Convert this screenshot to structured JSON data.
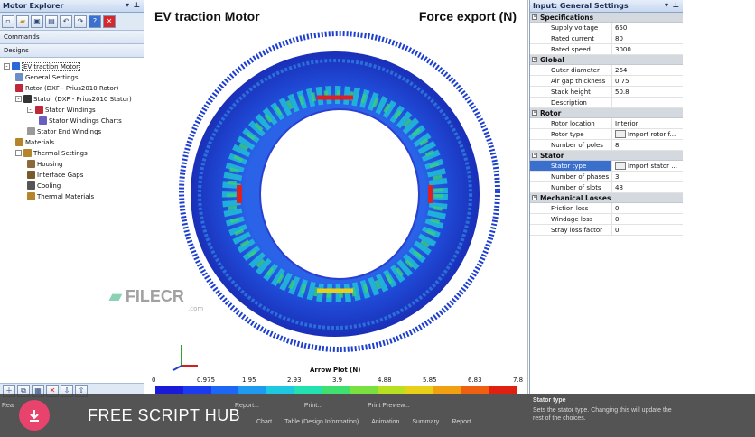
{
  "left_panel": {
    "title": "Motor Explorer",
    "pin_icons": [
      "▾",
      "⊥"
    ],
    "toolbar_icons": [
      "new-icon",
      "open-icon",
      "save-icon",
      "save-as-icon",
      "undo-icon",
      "redo-icon",
      "help-icon",
      "close-icon"
    ],
    "commands_label": "Commands",
    "designs_label": "Designs",
    "tree": [
      {
        "label": "EV traction Motor",
        "level": 0,
        "icon": "motor-icon",
        "color": "#2a6ad8",
        "exp": "-"
      },
      {
        "label": "General Settings",
        "level": 1,
        "icon": "gear-icon",
        "color": "#6a8fc9"
      },
      {
        "label": "Rotor (DXF - Prius2010 Rotor)",
        "level": 1,
        "icon": "rotor-icon",
        "color": "#c0283a"
      },
      {
        "label": "Stator (DXF - Prius2010 Stator)",
        "level": 1,
        "icon": "stator-icon",
        "color": "#333333",
        "exp": "-"
      },
      {
        "label": "Stator Windings",
        "level": 2,
        "icon": "windings-icon",
        "color": "#c0283a",
        "exp": "-"
      },
      {
        "label": "Stator Windings Charts",
        "level": 3,
        "icon": "chart-icon",
        "color": "#6a5fbf"
      },
      {
        "label": "Stator End Windings",
        "level": 2,
        "icon": "end-windings-icon",
        "color": "#9a9a9a"
      },
      {
        "label": "Materials",
        "level": 1,
        "icon": "materials-icon",
        "color": "#b5852c"
      },
      {
        "label": "Thermal Settings",
        "level": 1,
        "icon": "thermal-icon",
        "color": "#b5852c",
        "exp": "-"
      },
      {
        "label": "Housing",
        "level": 2,
        "icon": "housing-icon",
        "color": "#8a6a3a"
      },
      {
        "label": "Interface Gaps",
        "level": 2,
        "icon": "interface-gaps-icon",
        "color": "#7a5a2a"
      },
      {
        "label": "Cooling",
        "level": 2,
        "icon": "cooling-icon",
        "color": "#555555"
      },
      {
        "label": "Thermal Materials",
        "level": 2,
        "icon": "thermal-materials-icon",
        "color": "#b5852c"
      }
    ]
  },
  "center": {
    "title_left": "EV traction Motor",
    "title_right": "Force export (N)",
    "watermark": "FILECR",
    "watermark_sub": ".com",
    "colorbar": {
      "title": "Arrow Plot (N)",
      "ticks": [
        "0",
        "0.975",
        "1.95",
        "2.93",
        "3.9",
        "4.88",
        "5.85",
        "6.83",
        "7.8"
      ],
      "colors": [
        "#1a1ad8",
        "#1c3af0",
        "#1e66f5",
        "#1e9af0",
        "#1ec8e0",
        "#22e0b0",
        "#40e070",
        "#7ae040",
        "#b8e020",
        "#e8d018",
        "#f0a010",
        "#f06010",
        "#e02010"
      ]
    },
    "buttons": [
      "Report...",
      "Print...",
      "Print Preview..."
    ],
    "tabs": [
      "Chart",
      "Table (Design Information)",
      "Animation",
      "Summary",
      "Report"
    ]
  },
  "right_panel": {
    "title": "Input: General Settings",
    "groups": [
      {
        "name": "Specifications",
        "rows": [
          {
            "name": "Supply voltage",
            "value": "650"
          },
          {
            "name": "Rated current",
            "value": "80"
          },
          {
            "name": "Rated speed",
            "value": "3000"
          }
        ]
      },
      {
        "name": "Global",
        "rows": [
          {
            "name": "Outer diameter",
            "value": "264"
          },
          {
            "name": "Air gap thickness",
            "value": "0.75"
          },
          {
            "name": "Stack height",
            "value": "50.8"
          },
          {
            "name": "Description",
            "value": ""
          }
        ]
      },
      {
        "name": "Rotor",
        "rows": [
          {
            "name": "Rotor location",
            "value": "Interior"
          },
          {
            "name": "Rotor type",
            "value": "Import rotor f...",
            "button": true
          },
          {
            "name": "Number of poles",
            "value": "8"
          }
        ]
      },
      {
        "name": "Stator",
        "rows": [
          {
            "name": "Stator type",
            "value": "Import stator ...",
            "button": true,
            "selected": true
          },
          {
            "name": "Number of phases",
            "value": "3"
          },
          {
            "name": "Number of slots",
            "value": "48"
          }
        ]
      },
      {
        "name": "Mechanical Losses",
        "rows": [
          {
            "name": "Friction loss",
            "value": "0"
          },
          {
            "name": "Windage loss",
            "value": "0"
          },
          {
            "name": "Stray loss factor",
            "value": "0"
          }
        ]
      }
    ],
    "help_title": "Stator type",
    "help_text": "Sets the stator type. Changing this will update the rest of the choices."
  },
  "overlay": {
    "brand": "FREE SCRIPT HUB",
    "download_icon": "download-icon"
  }
}
